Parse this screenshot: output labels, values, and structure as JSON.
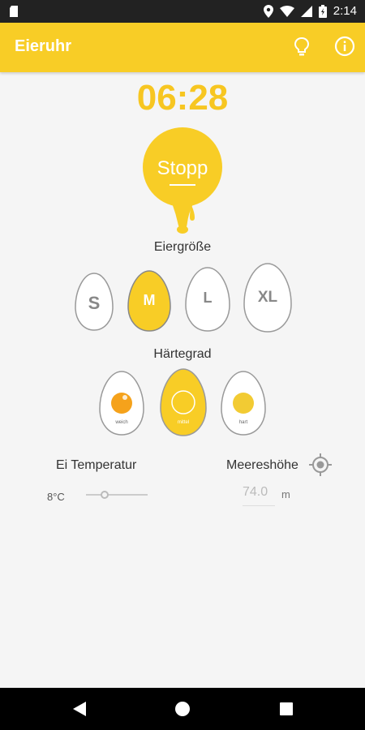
{
  "status_bar": {
    "time": "2:14"
  },
  "app_bar": {
    "title": "Eieruhr",
    "icons": [
      "lightbulb-icon",
      "info-icon"
    ]
  },
  "timer": {
    "value": "06:28"
  },
  "stop_button": {
    "label": "Stopp"
  },
  "egg_size": {
    "label": "Eiergröße",
    "options": [
      "S",
      "M",
      "L",
      "XL"
    ],
    "selected": "M"
  },
  "hardness": {
    "label": "Härtegrad",
    "options": [
      "weich",
      "mittel",
      "hart"
    ],
    "selected": "mittel"
  },
  "egg_temperature": {
    "label": "Ei Temperatur",
    "value": "8°C"
  },
  "altitude": {
    "label": "Meereshöhe",
    "value": "74.0",
    "unit": "m"
  },
  "colors": {
    "accent": "#f8cd26",
    "timer": "#f7c621",
    "yolk_soft": "#f5a21b",
    "yolk_medium": "#f8cd26",
    "yolk_hard": "#f2cb33"
  }
}
